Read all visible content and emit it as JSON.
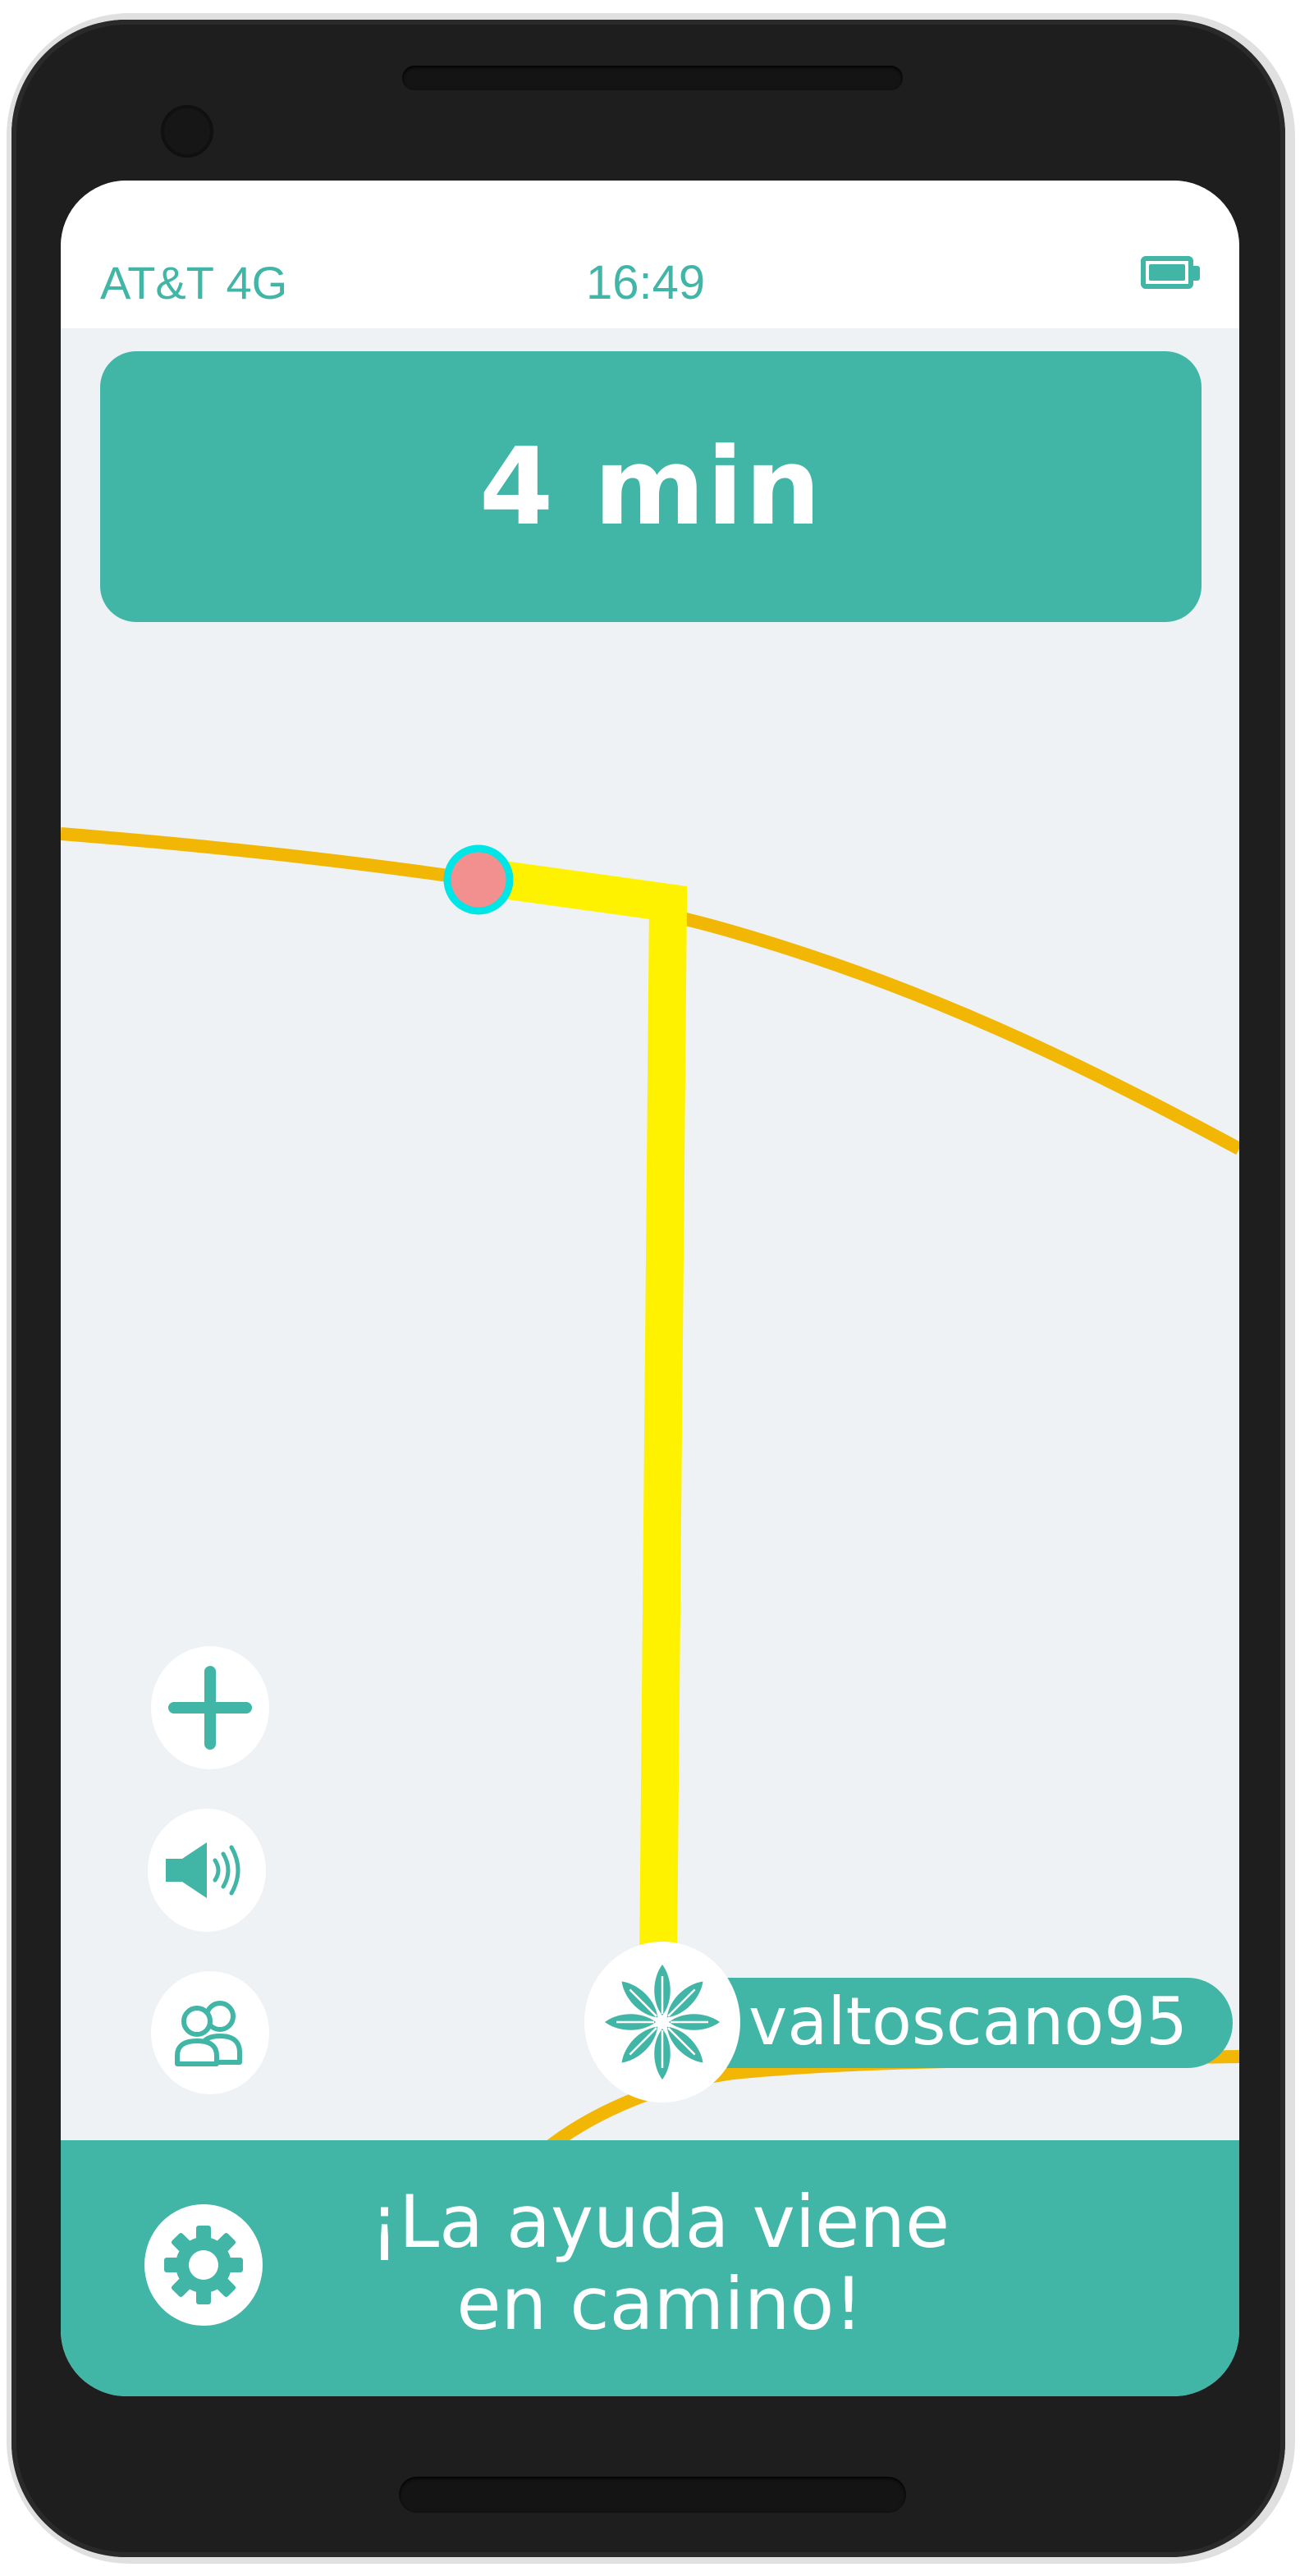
{
  "status_bar": {
    "carrier": "AT&T 4G",
    "time": "16:49",
    "battery_icon": "battery-full-icon"
  },
  "eta": {
    "text": "4 min"
  },
  "map": {
    "road_color": "#f2b705",
    "route_color": "#fff200",
    "marker_color": "#f29090",
    "marker_ring_color": "#00e5e5"
  },
  "controls": {
    "zoom_in_icon": "plus-icon",
    "sound_icon": "speaker-icon",
    "group_icon": "users-icon"
  },
  "user": {
    "username": "valtoscano95",
    "avatar_icon": "flower-logo-icon"
  },
  "bottom_bar": {
    "settings_icon": "gear-icon",
    "message_line1": "¡La ayuda viene",
    "message_line2": "en camino!"
  },
  "colors": {
    "accent": "#41b5a6",
    "map_background": "#eff2f5",
    "white": "#ffffff"
  }
}
